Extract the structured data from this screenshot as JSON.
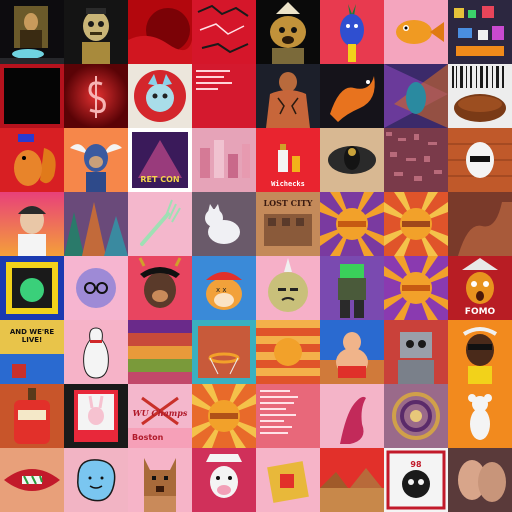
{
  "gallery": {
    "texts": {
      "retcon": "RET CON",
      "wichecks": "Wichecks",
      "lost_city": "LOST CITY",
      "fomo": "FOMO",
      "and_were_live": "AND WE'RE LIVE!",
      "wu_champs": "WU Champs",
      "boston": "Boston",
      "bracket_year": "98"
    }
  }
}
